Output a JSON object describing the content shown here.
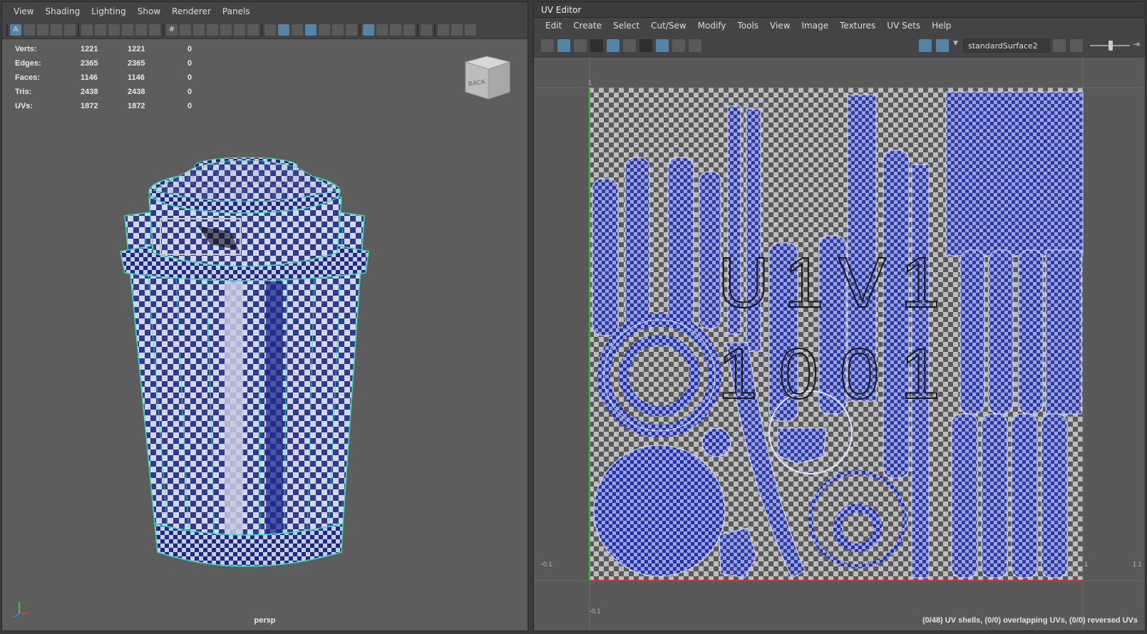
{
  "viewport_menu": [
    "View",
    "Shading",
    "Lighting",
    "Show",
    "Renderer",
    "Panels"
  ],
  "hud": {
    "rows": [
      {
        "label": "Verts:",
        "a": "1221",
        "b": "1221",
        "c": "0"
      },
      {
        "label": "Edges:",
        "a": "2365",
        "b": "2365",
        "c": "0"
      },
      {
        "label": "Faces:",
        "a": "1146",
        "b": "1146",
        "c": "0"
      },
      {
        "label": "Tris:",
        "a": "2438",
        "b": "2438",
        "c": "0"
      },
      {
        "label": "UVs:",
        "a": "1872",
        "b": "1872",
        "c": "0"
      }
    ]
  },
  "viewcube_label": "BACK",
  "camera_name": "persp",
  "uv_editor": {
    "title": "UV Editor",
    "menu": [
      "Edit",
      "Create",
      "Select",
      "Cut/Sew",
      "Modify",
      "Tools",
      "View",
      "Image",
      "Textures",
      "UV Sets",
      "Help"
    ],
    "material": "standardSurface2",
    "tile_label_1": "U1V1",
    "tile_label_2": "1001",
    "axis_labels": {
      "top_one": "1",
      "left_neg": "-0.1",
      "bottom_neg": "-0.1",
      "right_one": "1",
      "right_far": "1.1"
    },
    "status": "(0/48) UV shells, (0/0) overlapping UVs, (0/0) reversed UVs"
  },
  "colors": {
    "accent": "#5285a6",
    "uv_fill": "#1a2ea8",
    "wire": "#35e0b4"
  }
}
